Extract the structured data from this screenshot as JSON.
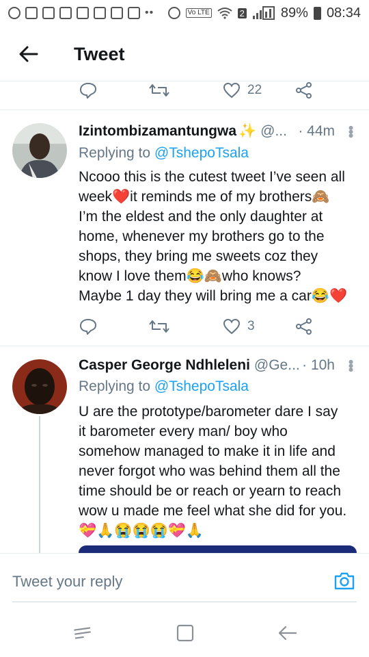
{
  "status_bar": {
    "battery": "89%",
    "time": "08:34",
    "sim": "2",
    "volte": "Vo LTE"
  },
  "header": {
    "title": "Tweet",
    "back_icon": "arrow-left-icon"
  },
  "top_actions": {
    "like_count": "22"
  },
  "tweets": [
    {
      "name": "Izintombizamantungwa",
      "name_emoji": "✨",
      "handle": "@...",
      "time": "· 44m",
      "replying_prefix": "Replying to",
      "replying_to": "@TshepoTsala",
      "lines": [
        "Ncooo this is the cutest tweet I’ve seen all",
        "week❤️it reminds me of my brothers🙈",
        "I’m the eldest and the only daughter at",
        "home, whenever my brothers go to the",
        "shops, they bring me sweets coz they",
        "know I love them😂🙈who knows?",
        "Maybe 1 day they will bring me a car😂❤️"
      ],
      "like_count": "3"
    },
    {
      "name": "Casper George Ndhleleni",
      "handle": "@Ge...",
      "time": "· 10h",
      "replying_prefix": "Replying to",
      "replying_to": "@TshepoTsala",
      "lines": [
        "U are the prototype/barometer dare I say",
        "it barometer every man/ boy who",
        "somehow managed to make it in life and",
        "never forgot who was behind them all the",
        "time should be or reach or yearn to reach",
        "wow u made me feel what she did for you.",
        "💝🙏😭😭😭💝🙏"
      ]
    }
  ],
  "composer": {
    "placeholder": "Tweet your reply"
  },
  "colors": {
    "accent": "#1da1f2",
    "secondary_text": "#657786",
    "divider": "#e6ecf0"
  }
}
